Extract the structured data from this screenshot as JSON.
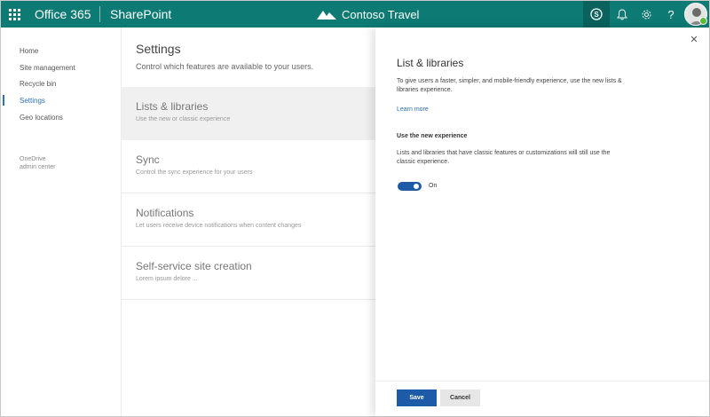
{
  "topbar": {
    "app_name": "Office 365",
    "product_name": "SharePoint",
    "brand_name": "Contoso Travel",
    "bg_color": "#0d7a73",
    "icons": [
      "skype-icon",
      "bell-icon",
      "gear-icon",
      "help-icon"
    ],
    "help_glyph": "?"
  },
  "leftnav": {
    "items": [
      {
        "label": "Home"
      },
      {
        "label": "Site management"
      },
      {
        "label": "Recycle bin"
      },
      {
        "label": "Settings",
        "active": true
      },
      {
        "label": "Geo locations"
      }
    ],
    "footer_line1": "OneDrive",
    "footer_line2": "admin center"
  },
  "main": {
    "title": "Settings",
    "subtitle": "Control which features are available to your users.",
    "rows": [
      {
        "title": "Lists & libraries",
        "desc": "Use the new or classic experience"
      },
      {
        "title": "Sync",
        "desc": "Control the sync experience for your users"
      },
      {
        "title": "Notifications",
        "desc": "Let users receive device notifications when content changes"
      },
      {
        "title": "Self-service site creation",
        "desc": "Lorem ipsum delore ..."
      }
    ]
  },
  "panel": {
    "close_glyph": "✕",
    "title": "List & libraries",
    "description": "To give users a faster, simpler, and mobile-friendly experience, use the new lists & libraries experience.",
    "link": "Learn more",
    "subheading": "Use the new experience",
    "note": "Lists and libraries that have classic features or customizations will still use the classic experience.",
    "toggle_label": "On",
    "toggle_on": true,
    "save_label": "Save",
    "cancel_label": "Cancel",
    "accent_color": "#1d5aa8"
  }
}
